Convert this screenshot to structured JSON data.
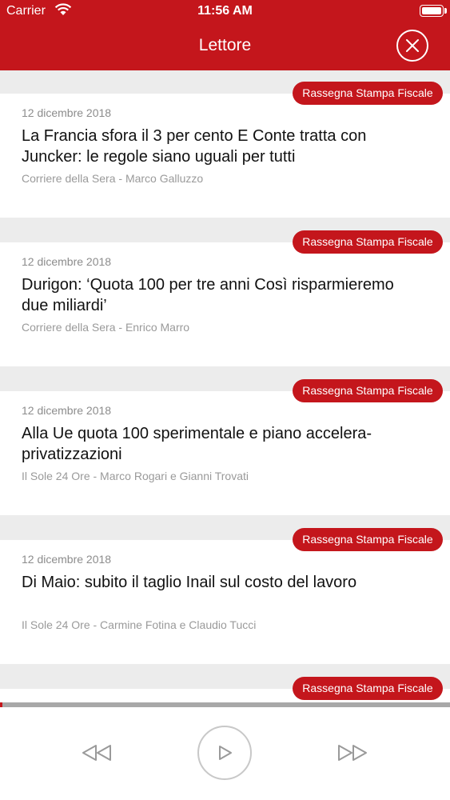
{
  "status_bar": {
    "carrier": "Carrier",
    "time": "11:56 AM"
  },
  "header": {
    "title": "Lettore"
  },
  "badge_label": "Rassegna Stampa Fiscale",
  "articles": [
    {
      "date": "12 dicembre 2018",
      "headline": "La Francia sfora il 3 per cento E Conte tratta con Juncker: le regole siano uguali per tutti",
      "source": "Corriere della Sera - Marco Galluzzo"
    },
    {
      "date": "12 dicembre 2018",
      "headline": "Durigon: ‘Quota 100 per tre anni Così risparmieremo due miliardi’",
      "source": "Corriere della Sera - Enrico Marro"
    },
    {
      "date": "12 dicembre 2018",
      "headline": "Alla Ue quota 100 sperimentale e piano accelera-privatizzazioni",
      "source": "Il Sole 24 Ore - Marco Rogari e Gianni Trovati"
    },
    {
      "date": "12 dicembre 2018",
      "headline": "Di Maio: subito il taglio Inail sul costo del lavoro",
      "source": "Il Sole 24 Ore - Carmine Fotina e Claudio Tucci"
    }
  ],
  "player": {
    "progress_fraction": 0.005
  },
  "colors": {
    "accent": "#c4161c",
    "background": "#ececec",
    "icon_gray": "#9a9a9a"
  },
  "icons": [
    "wifi-icon",
    "battery-icon",
    "close-icon",
    "rewind-icon",
    "play-icon",
    "fast-forward-icon"
  ]
}
